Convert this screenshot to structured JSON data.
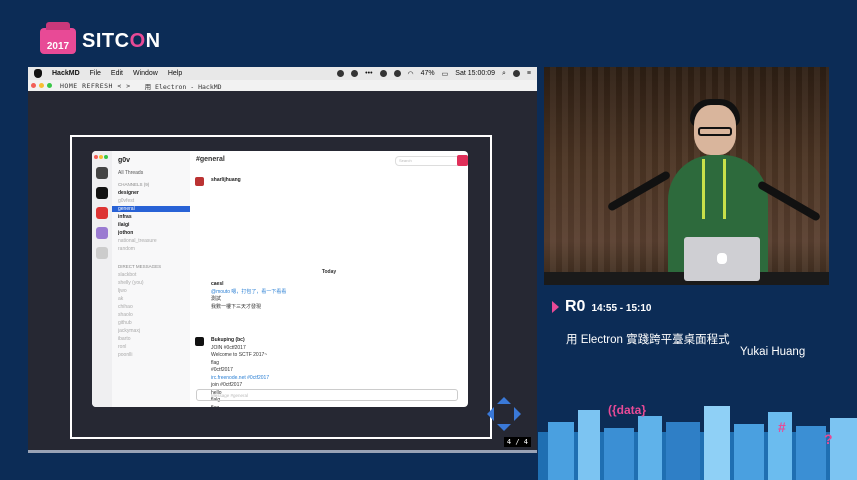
{
  "branding": {
    "badge_year": "2017",
    "name_prefix": "SITC",
    "name_o": "O",
    "name_suffix": "N"
  },
  "mac_menubar": {
    "app": "HackMD",
    "menus": [
      "File",
      "Edit",
      "Window",
      "Help"
    ],
    "battery": "47%",
    "clock": "Sat 15:00:09"
  },
  "window_bar": {
    "nav": "HOME  REFRESH  <  >",
    "title": "用 Electron - HackMD"
  },
  "slack": {
    "workspace": "g0v",
    "sidebar": {
      "all_threads": "All Threads",
      "channels_header": "CHANNELS (9)",
      "channels": [
        "designer",
        "g0vfest",
        "general",
        "infras",
        "ilaigi",
        "jothon",
        "national_treasure",
        "random"
      ],
      "selected_channel": "general",
      "dm_header": "DIRECT MESSAGES",
      "dms": [
        "slackbot",
        "shelly (you)",
        "ljwo",
        "ak",
        "chihao",
        "shaolo",
        "github",
        "jackymaxj",
        "ibarto",
        "ronl",
        "poonlli"
      ]
    },
    "channel": {
      "title": "#general",
      "search_placeholder": "Search",
      "today_label": "Today",
      "messages": [
        {
          "who": "sharlijhuang",
          "lines": []
        },
        {
          "who": "caesl",
          "lines": [
            "@mouto 嗯，打包了，看一下看看",
            "測試",
            "我數一樓下三天才發現"
          ]
        },
        {
          "who": "Bukuping (bc)",
          "lines": [
            "JOIN #0ctf2017",
            "Welcome to SCTF 2017~",
            "flag",
            "#0ctf2017",
            "irc.freenode.net #0ctf2017",
            "join #0ctf2017",
            "hello",
            "flalg",
            "flag"
          ]
        },
        {
          "who": "aceshen",
          "lines": [
            "原來這種有flag (嘿)"
          ]
        }
      ],
      "compose_placeholder": "Message #general"
    }
  },
  "slide_counter": "4 / 4",
  "session": {
    "room": "R0",
    "time": "14:55 - 15:10",
    "title": "用 Electron 實踐跨平臺桌面程式",
    "speaker": "Yukai Huang"
  },
  "colors": {
    "background": "#0c2c56",
    "accent": "#e84a96"
  }
}
